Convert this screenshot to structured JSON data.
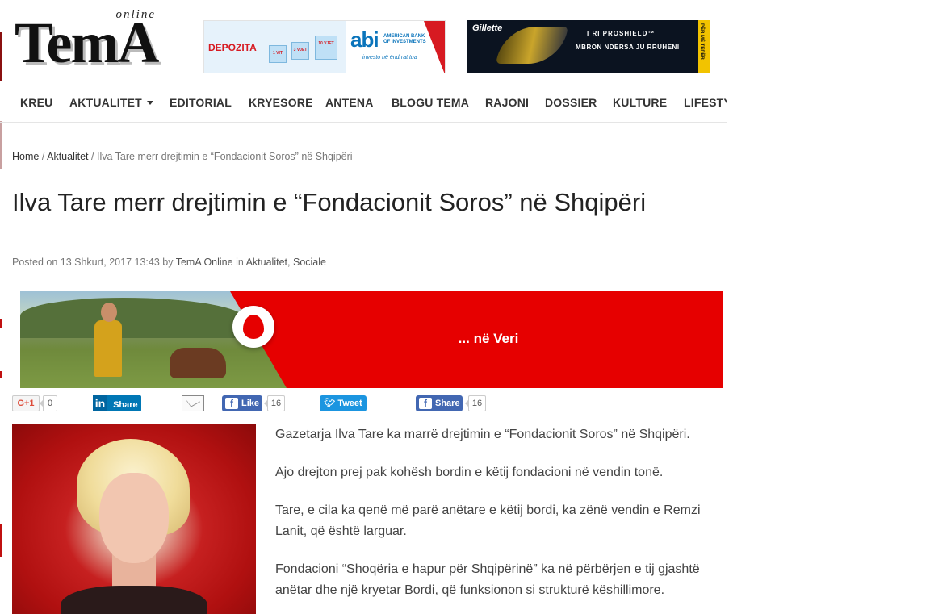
{
  "site": {
    "logo_word": "TemA",
    "logo_tag": "online"
  },
  "ads": {
    "abi": {
      "depozita": "DEPOZITA",
      "gifts": [
        "1 VIT",
        "3 VJET",
        "10 VJET"
      ],
      "brand": "abi",
      "brand_sub_1": "AMERICAN BANK",
      "brand_sub_2": "OF INVESTMENTS",
      "slogan": "investo në ëndrrat tua",
      "accent": "#d71a21",
      "brand_color": "#0a74bb"
    },
    "gillette": {
      "brand": "Gillette",
      "line1": "I RI PROSHIELD™",
      "line2": "MBRON NDËRSA JU RRUHENI",
      "side": "PËR MË TEPËR"
    }
  },
  "nav": {
    "items": [
      {
        "label": "KREU"
      },
      {
        "label": "AKTUALITET"
      },
      {
        "label": "EDITORIAL"
      },
      {
        "label": "KRYESORE"
      },
      {
        "label": "ANTENA"
      },
      {
        "label": "BLOGU TEMA"
      },
      {
        "label": "RAJONI"
      },
      {
        "label": "DOSSIER"
      },
      {
        "label": "KULTURE"
      },
      {
        "label": "LIFESTYLE"
      }
    ]
  },
  "breadcrumb": {
    "home": "Home",
    "section": "Aktualitet",
    "current": "Ilva Tare merr drejtimin e “Fondacionit Soros” në Shqipëri",
    "separator": "/"
  },
  "article": {
    "title": "Ilva Tare merr drejtimin e “Fondacionit Soros” në Shqipëri",
    "meta_posted": "Posted on 13 Shkurt, 2017 13:43 by",
    "meta_author": "TemA Online",
    "meta_in": "in",
    "meta_cat1": "Aktualitet",
    "meta_comma": ",",
    "meta_cat2": "Sociale",
    "paragraphs": [
      "Gazetarja Ilva Tare ka marrë drejtimin e “Fondacionit Soros” në Shqipëri.",
      "Ajo drejton prej pak kohësh bordin e këtij fondacioni në vendin tonë.",
      "Tare, e cila ka qenë më parë anëtare e këtij bordi, ka zënë vendin e Remzi Lanit, që është larguar.",
      "Fondacioni “Shoqëria e hapur për Shqipërinë” ka në përbërjen e tij gjashtë anëtar dhe një kryetar Bordi, që funksionon si strukturë këshillimore."
    ]
  },
  "banner": {
    "slogan": "... në Veri",
    "color": "#e60000"
  },
  "social": {
    "gplus_label": "G+1",
    "gplus_count": "0",
    "linkedin_label": "Share",
    "linkedin_in": "in",
    "fb_like_label": "Like",
    "fb_like_count": "16",
    "tweet_label": "Tweet",
    "fb_share_label": "Share",
    "fb_share_count": "16",
    "fb_f": "f"
  }
}
